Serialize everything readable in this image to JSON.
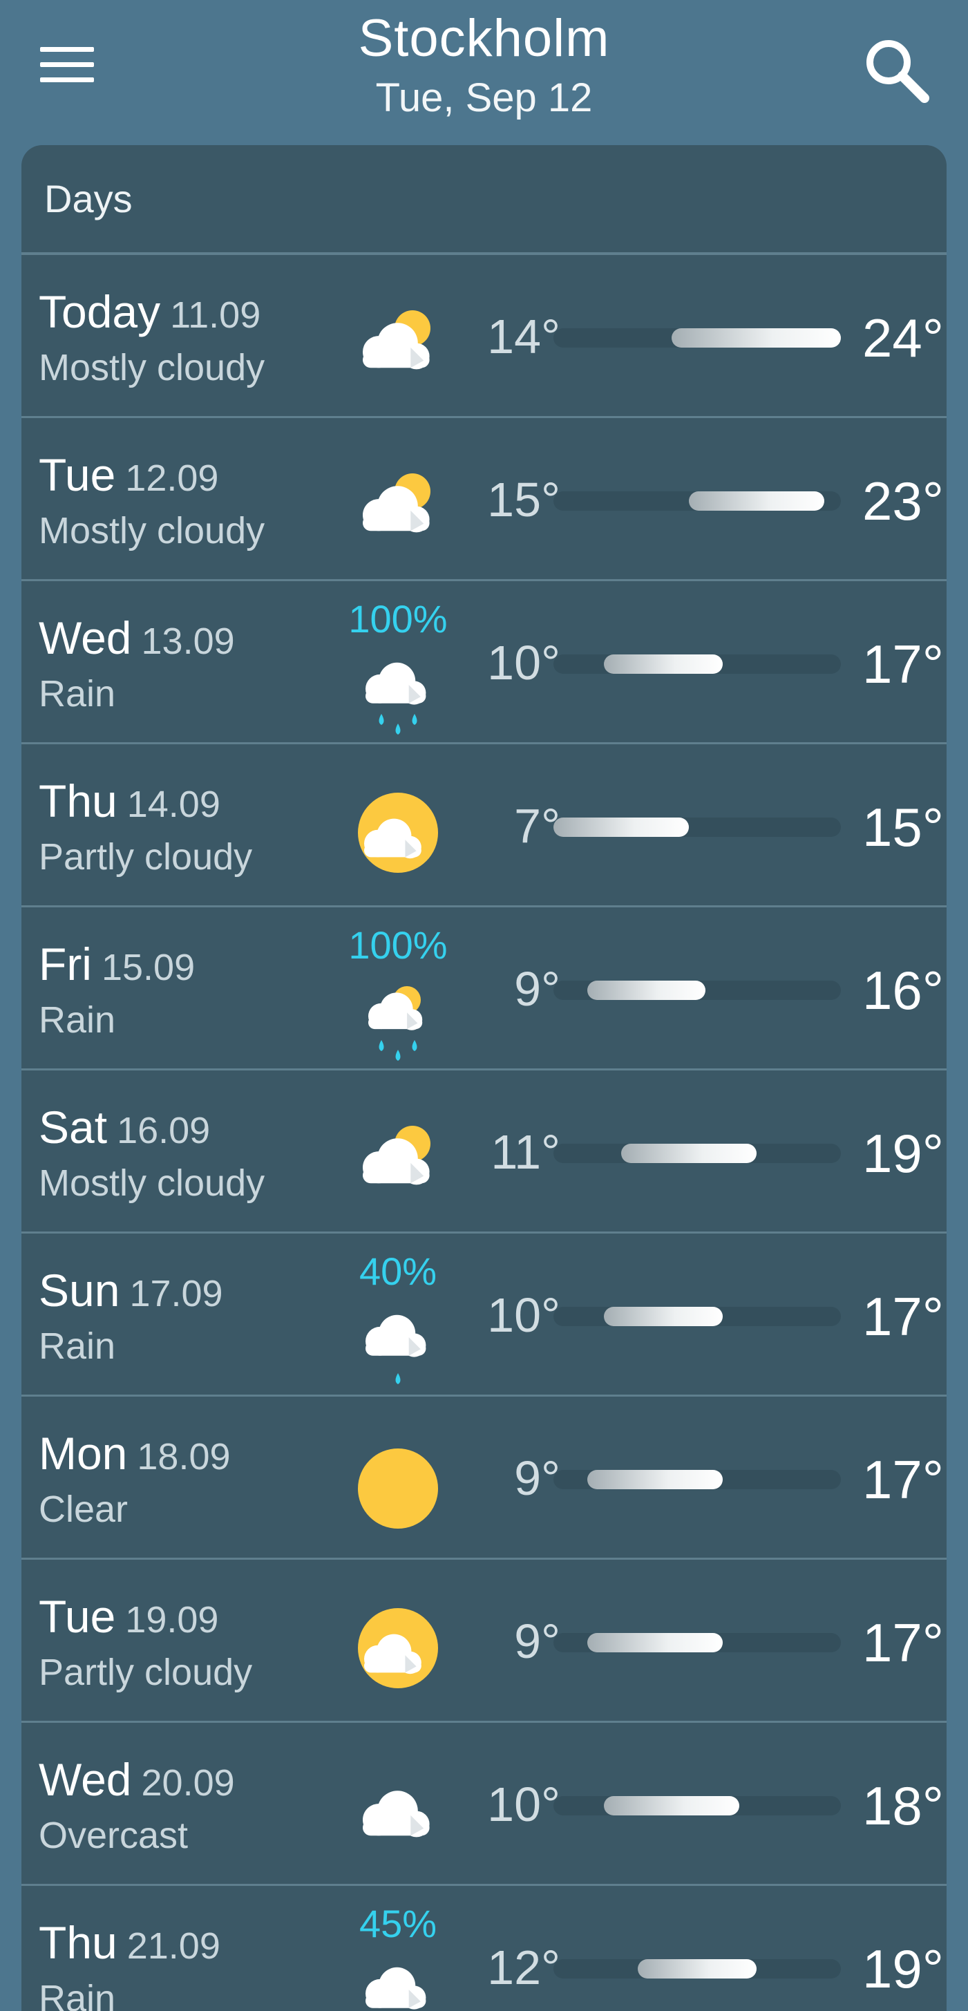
{
  "header": {
    "city": "Stockholm",
    "date": "Tue, Sep 12"
  },
  "panel": {
    "title": "Days"
  },
  "temp_scale": {
    "min": 7,
    "max": 24
  },
  "days": [
    {
      "day": "Today",
      "date": "11.09",
      "condition": "Mostly cloudy",
      "precip": "",
      "icon": "sun-behind-cloud-icon",
      "low": 14,
      "high": 24,
      "low_label": "14°",
      "high_label": "24°"
    },
    {
      "day": "Tue",
      "date": "12.09",
      "condition": "Mostly cloudy",
      "precip": "",
      "icon": "sun-behind-cloud-icon",
      "low": 15,
      "high": 23,
      "low_label": "15°",
      "high_label": "23°"
    },
    {
      "day": "Wed",
      "date": "13.09",
      "condition": "Rain",
      "precip": "100%",
      "icon": "rain-cloud-icon",
      "low": 10,
      "high": 17,
      "low_label": "10°",
      "high_label": "17°"
    },
    {
      "day": "Thu",
      "date": "14.09",
      "condition": "Partly cloudy",
      "precip": "",
      "icon": "partly-cloudy-icon",
      "low": 7,
      "high": 15,
      "low_label": "7°",
      "high_label": "15°"
    },
    {
      "day": "Fri",
      "date": "15.09",
      "condition": "Rain",
      "precip": "100%",
      "icon": "sun-rain-cloud-icon",
      "low": 9,
      "high": 16,
      "low_label": "9°",
      "high_label": "16°"
    },
    {
      "day": "Sat",
      "date": "16.09",
      "condition": "Mostly cloudy",
      "precip": "",
      "icon": "sun-behind-cloud-icon",
      "low": 11,
      "high": 19,
      "low_label": "11°",
      "high_label": "19°"
    },
    {
      "day": "Sun",
      "date": "17.09",
      "condition": "Rain",
      "precip": "40%",
      "icon": "light-rain-cloud-icon",
      "low": 10,
      "high": 17,
      "low_label": "10°",
      "high_label": "17°"
    },
    {
      "day": "Mon",
      "date": "18.09",
      "condition": "Clear",
      "precip": "",
      "icon": "sun-icon",
      "low": 9,
      "high": 17,
      "low_label": "9°",
      "high_label": "17°"
    },
    {
      "day": "Tue",
      "date": "19.09",
      "condition": "Partly cloudy",
      "precip": "",
      "icon": "partly-cloudy-icon",
      "low": 9,
      "high": 17,
      "low_label": "9°",
      "high_label": "17°"
    },
    {
      "day": "Wed",
      "date": "20.09",
      "condition": "Overcast",
      "precip": "",
      "icon": "cloud-icon",
      "low": 10,
      "high": 18,
      "low_label": "10°",
      "high_label": "18°"
    },
    {
      "day": "Thu",
      "date": "21.09",
      "condition": "Rain",
      "precip": "45%",
      "icon": "rain-cloud-icon",
      "low": 12,
      "high": 19,
      "low_label": "12°",
      "high_label": "19°"
    }
  ],
  "colors": {
    "background": "#4d768e",
    "panel": "#3b5866",
    "precip": "#35d1ee",
    "sun": "#fcc940",
    "cloud": "#ffffff"
  }
}
